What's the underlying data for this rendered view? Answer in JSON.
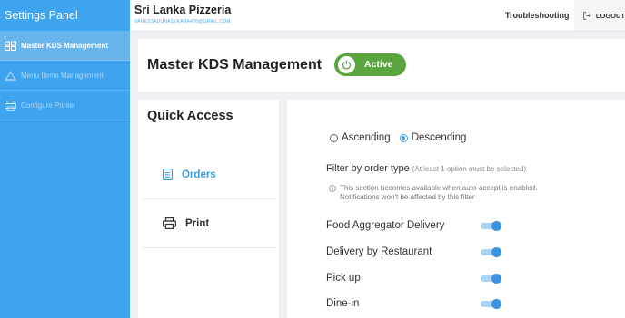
{
  "sidebar": {
    "title": "Settings Panel",
    "items": [
      {
        "label": "Master KDS Management",
        "icon": "kds-icon",
        "active": true
      },
      {
        "label": "Menu Items Management",
        "icon": "menu-items-icon",
        "active": false
      },
      {
        "label": "Configure Printer",
        "icon": "printer-icon",
        "active": false
      }
    ]
  },
  "header": {
    "shop_name": "Sri Lanka Pizzeria",
    "email": "VANESSADUNASEKARA476@GMAIL.COM",
    "troubleshooting": "Troubleshooting",
    "logout": "LOGOUT"
  },
  "kds": {
    "title": "Master KDS Management",
    "status": "Active",
    "status_color": "#5aa53d"
  },
  "quick_access": {
    "title": "Quick Access",
    "items": [
      {
        "label": "Orders",
        "icon": "orders-icon"
      },
      {
        "label": "Print",
        "icon": "print-icon"
      }
    ]
  },
  "sort": {
    "options": [
      "Ascending",
      "Descending"
    ],
    "selected": "Descending"
  },
  "filter": {
    "title": "Filter by order type",
    "hint": "(At least 1 option must be selected)",
    "note_line1": "This section becomes available when auto-accept is enabled.",
    "note_line2": "Notifications won't be affected by this filter",
    "types": [
      {
        "label": "Food Aggregator Delivery",
        "enabled": true
      },
      {
        "label": "Delivery by Restaurant",
        "enabled": true
      },
      {
        "label": "Pick up",
        "enabled": true
      },
      {
        "label": "Dine-in",
        "enabled": true
      }
    ]
  },
  "colors": {
    "sidebar": "#3fa4ef",
    "accent": "#3d9be0",
    "active_green": "#5aa53d"
  }
}
